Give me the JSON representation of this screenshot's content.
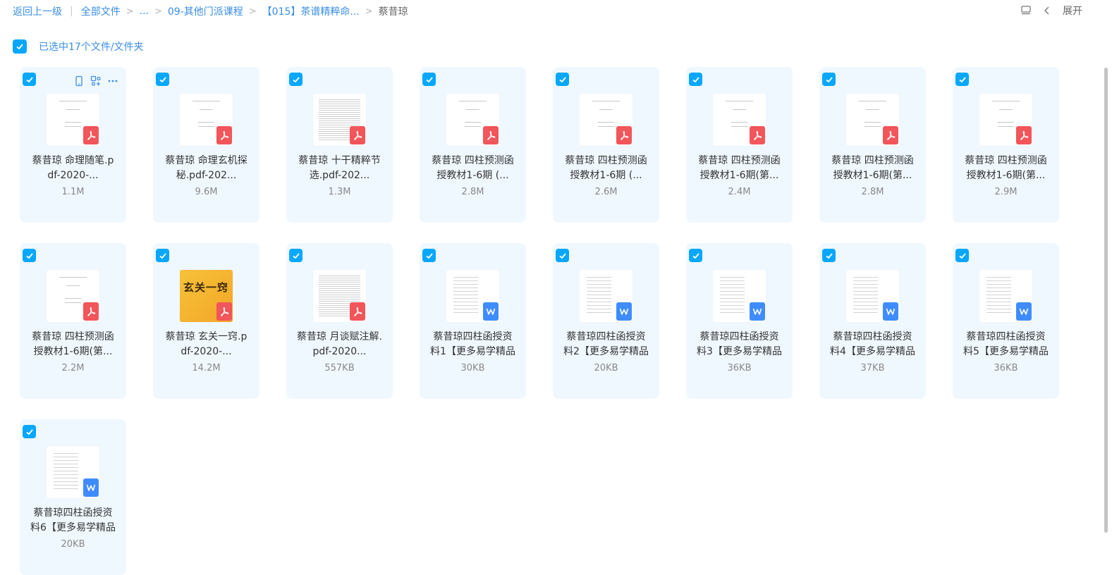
{
  "breadcrumb": {
    "back": "返回上一级",
    "items": [
      "全部文件",
      "...",
      "09-其他门派课程",
      "【015】茶谱精粹命...",
      "蔡昔琼"
    ]
  },
  "toolbar": {
    "expand": "展开"
  },
  "selection": {
    "text": "已选中17个文件/文件夹"
  },
  "colors": {
    "accent": "#06a7ff",
    "pdf_badge": "#f2555a",
    "doc_badge": "#3f8cff",
    "card_bg": "#f0f8ff"
  },
  "files": [
    {
      "line1": "蔡昔琼 命理随笔.p",
      "line2": "df-2020-...",
      "size": "1.1M",
      "type": "pdf"
    },
    {
      "line1": "蔡昔琼 命理玄机探",
      "line2": "秘.pdf-202...",
      "size": "9.6M",
      "type": "pdf"
    },
    {
      "line1": "蔡昔琼 十干精粹节",
      "line2": "选.pdf-202...",
      "size": "1.3M",
      "type": "pdf"
    },
    {
      "line1": "蔡昔琼 四柱预测函",
      "line2": "授教材1-6期 (...",
      "size": "2.8M",
      "type": "pdf"
    },
    {
      "line1": "蔡昔琼 四柱预测函",
      "line2": "授教材1-6期 (...",
      "size": "2.6M",
      "type": "pdf"
    },
    {
      "line1": "蔡昔琼 四柱预测函",
      "line2": "授教材1-6期(第...",
      "size": "2.4M",
      "type": "pdf"
    },
    {
      "line1": "蔡昔琼 四柱预测函",
      "line2": "授教材1-6期(第...",
      "size": "2.8M",
      "type": "pdf"
    },
    {
      "line1": "蔡昔琼 四柱预测函",
      "line2": "授教材1-6期(第...",
      "size": "2.9M",
      "type": "pdf"
    },
    {
      "line1": "蔡昔琼 四柱预测函",
      "line2": "授教材1-6期(第...",
      "size": "2.2M",
      "type": "pdf"
    },
    {
      "line1": "蔡昔琼 玄关一窍.p",
      "line2": "df-2020-...",
      "size": "14.2M",
      "type": "pdf"
    },
    {
      "line1": "蔡昔琼 月谈赋注解.",
      "line2": "pdf-2020...",
      "size": "557KB",
      "type": "pdf"
    },
    {
      "line1": "蔡昔琼四柱函授资",
      "line2": "料1【更多易学精品",
      "size": "30KB",
      "type": "doc"
    },
    {
      "line1": "蔡昔琼四柱函授资",
      "line2": "料2【更多易学精品",
      "size": "20KB",
      "type": "doc"
    },
    {
      "line1": "蔡昔琼四柱函授资",
      "line2": "料3【更多易学精品",
      "size": "36KB",
      "type": "doc"
    },
    {
      "line1": "蔡昔琼四柱函授资",
      "line2": "料4【更多易学精品",
      "size": "37KB",
      "type": "doc"
    },
    {
      "line1": "蔡昔琼四柱函授资",
      "line2": "料5【更多易学精品",
      "size": "36KB",
      "type": "doc"
    },
    {
      "line1": "蔡昔琼四柱函授资",
      "line2": "料6【更多易学精品",
      "size": "20KB",
      "type": "doc"
    }
  ],
  "cover": {
    "title": "玄关一窍"
  }
}
